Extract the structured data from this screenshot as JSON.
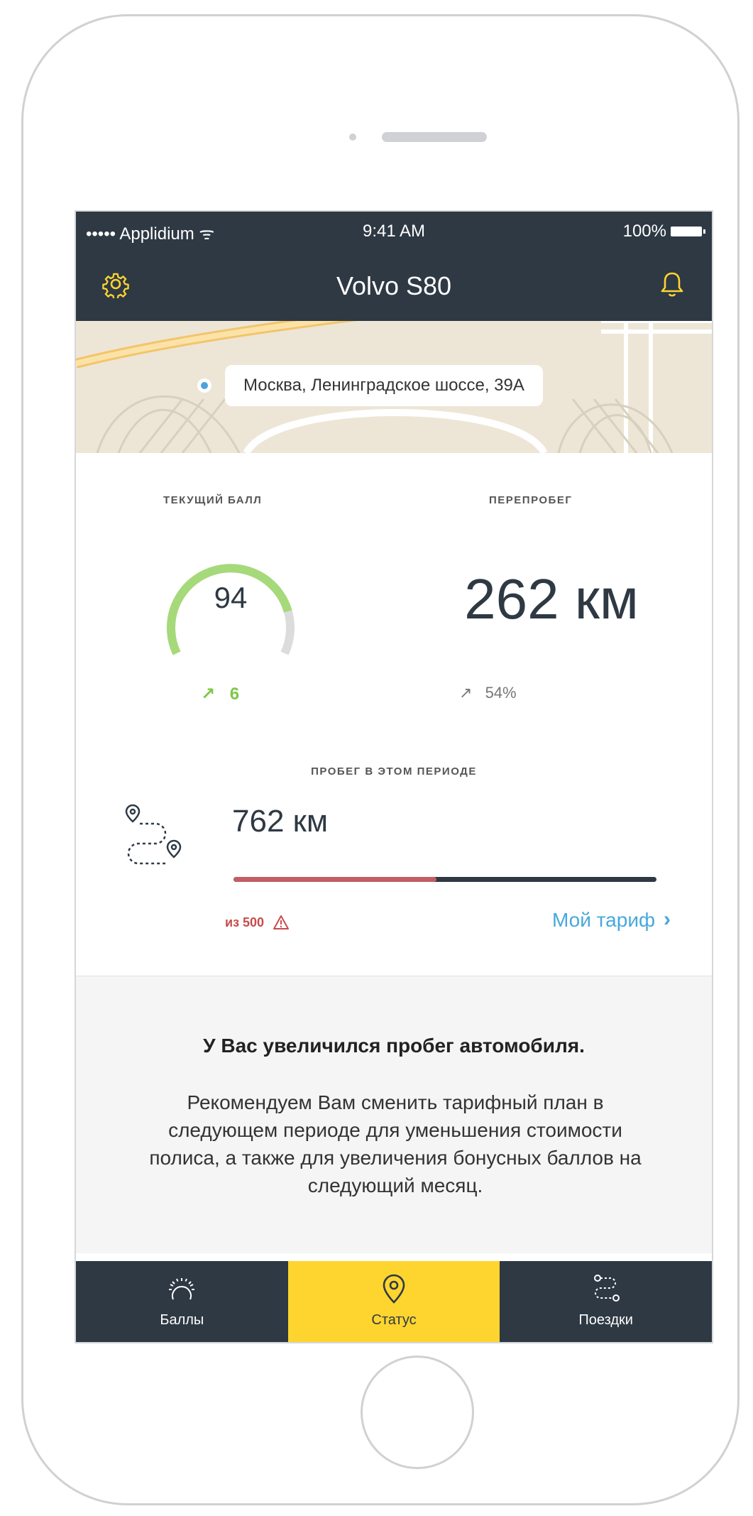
{
  "status_bar": {
    "carrier": "••••• Applidium",
    "wifi_glyph": "ᯤ",
    "time": "9:41 AM",
    "battery": "100%"
  },
  "nav": {
    "title": "Volvo S80",
    "settings_icon": "gear-icon",
    "notifications_icon": "bell-icon"
  },
  "map": {
    "address": "Москва, Ленинградское шоссе, 39А"
  },
  "score": {
    "label": "ТЕКУЩИЙ БАЛЛ",
    "value": "94",
    "delta_arrow": "↗",
    "delta": "6",
    "gauge_level": 0.82
  },
  "overrun": {
    "label": "ПЕРЕПРОБЕГ",
    "value": "262 км",
    "delta_arrow": "↗",
    "delta": "54%"
  },
  "mileage": {
    "label": "ПРОБЕГ В ЭТОМ ПЕРИОДЕ",
    "value": "762 км",
    "limit_text": "из 500",
    "warning_icon": "warning-icon",
    "progress_fraction": 0.48,
    "tariff_link": "Мой тариф",
    "tariff_chevron": "›"
  },
  "notice": {
    "title": "У Вас увеличился пробег автомобиля.",
    "body": "Рекомендуем Вам сменить тарифный план в следующем периоде для уменьшения стоимости полиса, а также для увеличения бонусных баллов на следующий месяц."
  },
  "tabs": [
    {
      "label": "Баллы",
      "icon": "speedometer-icon",
      "active": false
    },
    {
      "label": "Статус",
      "icon": "location-pin-icon",
      "active": true
    },
    {
      "label": "Поездки",
      "icon": "route-icon",
      "active": false
    }
  ],
  "colors": {
    "dark": "#2e3944",
    "accent_yellow": "#fed52f",
    "green": "#7ec845",
    "red": "#c45c63",
    "link_blue": "#48a8dc"
  }
}
